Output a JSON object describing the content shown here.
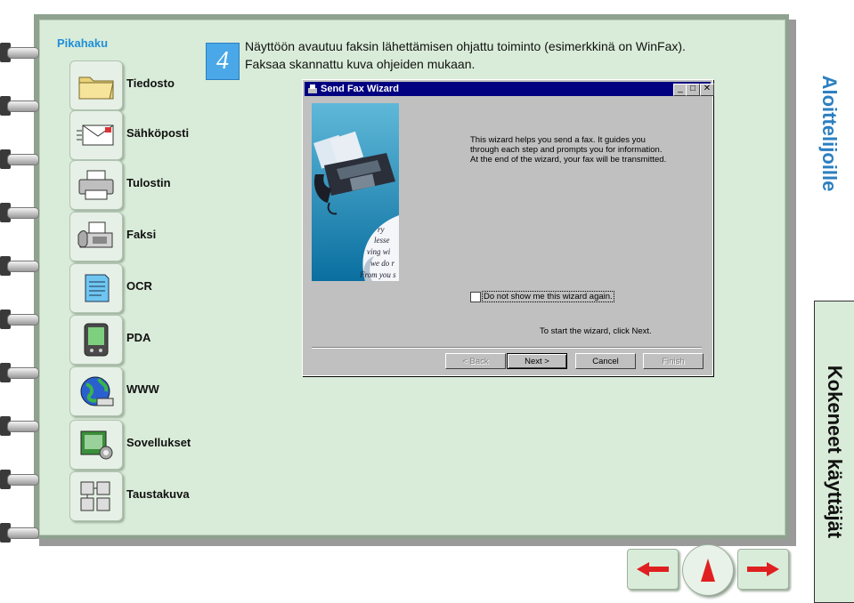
{
  "sidebar": {
    "title": "Pikahaku",
    "items": [
      {
        "label": "Tiedosto",
        "icon": "folder-icon"
      },
      {
        "label": "Sähköposti",
        "icon": "email-icon"
      },
      {
        "label": "Tulostin",
        "icon": "printer-icon"
      },
      {
        "label": "Faksi",
        "icon": "fax-icon"
      },
      {
        "label": "OCR",
        "icon": "ocr-document-icon"
      },
      {
        "label": "PDA",
        "icon": "pda-icon"
      },
      {
        "label": "WWW",
        "icon": "globe-icon"
      },
      {
        "label": "Sovellukset",
        "icon": "applications-icon"
      },
      {
        "label": "Taustakuva",
        "icon": "wallpaper-icon"
      }
    ]
  },
  "step": {
    "number": "4",
    "line1": "Näyttöön avautuu faksin lähettämisen ohjattu toiminto (esimerkkinä on WinFax).",
    "line2": "Faksaa skannattu kuva ohjeiden mukaan."
  },
  "wizard": {
    "title": "Send Fax Wizard",
    "intro_lines": [
      "This wizard helps you send a fax. It guides you",
      "through each step and prompts you for information.",
      "At the end of the wizard, your fax will be transmitted."
    ],
    "checkbox_label": "Do not show me this wizard again.",
    "checkbox_checked": false,
    "start_text": "To start the wizard, click Next.",
    "buttons": {
      "back": "< Back",
      "next": "Next >",
      "cancel": "Cancel",
      "finish": "Finish"
    },
    "image_script": [
      "ry",
      "lesse",
      "ving wi",
      "we do r",
      "From you s"
    ]
  },
  "tabs": {
    "beginners": "Aloittelijoille",
    "experienced": "Kokeneet käyttäjät"
  },
  "colors": {
    "accent": "#1f8fd8",
    "page": "#d9ecd9",
    "nav_arrow": "#e02020"
  }
}
